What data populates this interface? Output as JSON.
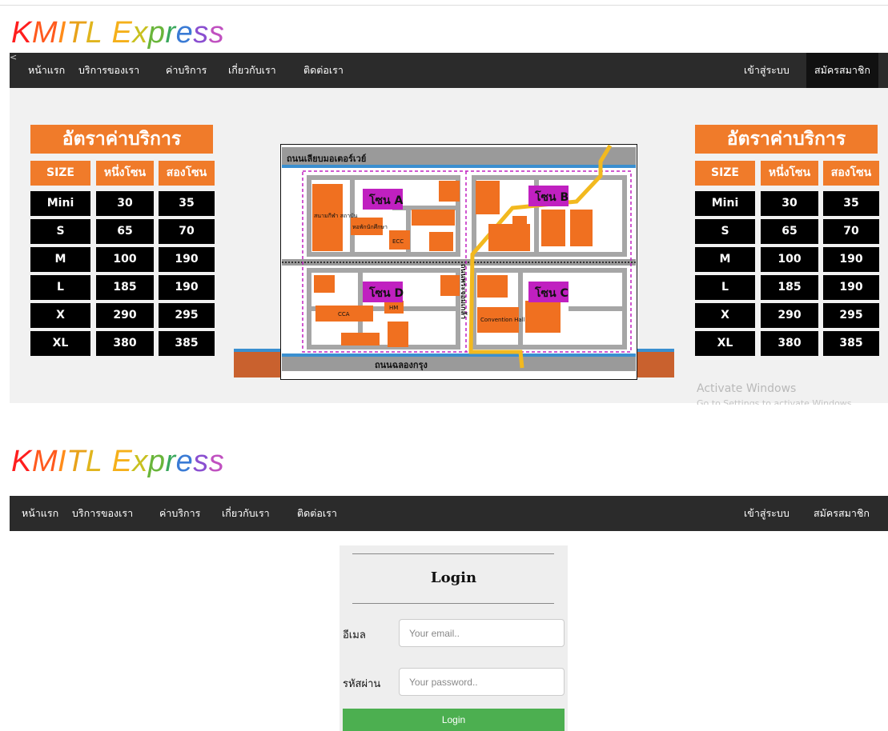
{
  "brand": {
    "logo_letters": [
      "K",
      "M",
      "I",
      "T",
      "L",
      " ",
      "E",
      "x",
      "p",
      "r",
      "e",
      "s",
      "s"
    ],
    "logo_colors": [
      "#ff1e1e",
      "#ff5a1e",
      "#ff8c1a",
      "#e8a21a",
      "#e0b51e",
      "#000000",
      "#f5b01a",
      "#c8c020",
      "#69b53a",
      "#3aa85c",
      "#3a7bd5",
      "#8a4fd0",
      "#c050c0"
    ]
  },
  "nav": {
    "items": [
      "หน้าแรก",
      "บริการของเรา",
      "ค่าบริการ",
      "เกี่ยวกับเรา",
      "ติดต่อเรา"
    ],
    "login": "เข้าสู่ระบบ",
    "register": "สมัครสมาชิก"
  },
  "corner_glyph": "<",
  "rates": {
    "title": "อัตราค่าบริการ",
    "headers": [
      "SIZE",
      "หนึ่งโซน",
      "สองโซน"
    ],
    "rows": [
      [
        "Mini",
        "30",
        "35"
      ],
      [
        "S",
        "65",
        "70"
      ],
      [
        "M",
        "100",
        "190"
      ],
      [
        "L",
        "185",
        "190"
      ],
      [
        "X",
        "290",
        "295"
      ],
      [
        "XL",
        "380",
        "385"
      ]
    ]
  },
  "map": {
    "top_road": "ถนนเลียบมอเตอร์เวย์",
    "bottom_road": "ถนนฉลองกรุง",
    "side_road": "ถนนพระจอมเกล้า",
    "zones": [
      "โซน A",
      "โซน B",
      "โซน C",
      "โซน D"
    ],
    "buildings": [
      "สนามกีฬา สถาบัน",
      "หอพักนักศึกษา",
      "ECC",
      "HM",
      "CCA",
      "Convention Hall"
    ]
  },
  "watermark": {
    "title": "Activate Windows",
    "subtitle": "Go to Settings to activate Windows."
  },
  "login": {
    "title": "Login",
    "email_label": "อีเมล",
    "email_placeholder": "Your email..",
    "password_label": "รหัสผ่าน",
    "password_placeholder": "Your password..",
    "button": "Login"
  },
  "colors": {
    "nav_bg": "#2b2b2b",
    "accent_orange": "#f07b2a",
    "zone_purple": "#c020c0",
    "login_green": "#4caf50"
  }
}
